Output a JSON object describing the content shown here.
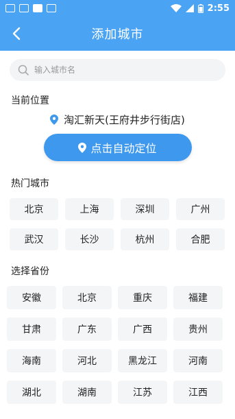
{
  "status_bar": {
    "time": "2:55"
  },
  "header": {
    "title": "添加城市"
  },
  "search": {
    "placeholder": "输入城市名"
  },
  "current_location": {
    "section_title": "当前位置",
    "place": "淘汇新天(王府井步行街店)",
    "locate_button": "点击自动定位"
  },
  "hot_cities": {
    "section_title": "热门城市",
    "items": [
      "北京",
      "上海",
      "深圳",
      "广州",
      "武汉",
      "长沙",
      "杭州",
      "合肥"
    ]
  },
  "provinces": {
    "section_title": "选择省份",
    "items": [
      "安徽",
      "北京",
      "重庆",
      "福建",
      "甘肃",
      "广东",
      "广西",
      "贵州",
      "海南",
      "河北",
      "黑龙江",
      "河南",
      "湖北",
      "湖南",
      "江苏",
      "江西"
    ]
  },
  "colors": {
    "accent": "#4aa3f3",
    "button": "#3d98ee",
    "chip_bg": "#f4f5f7"
  }
}
